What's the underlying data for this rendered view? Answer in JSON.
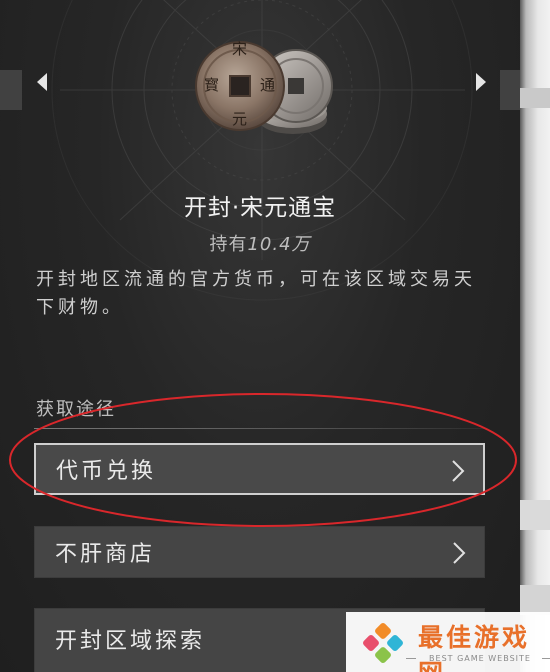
{
  "currency": {
    "name": "开封·宋元通宝",
    "holding_prefix": "持有",
    "holding_amount": "10.4万",
    "description": "开封地区流通的官方货币，可在该区域交易天下财物。",
    "coin_glyphs": [
      "宋",
      "通",
      "元",
      "寳"
    ]
  },
  "acquire": {
    "section_label": "获取途径",
    "items": [
      {
        "label": "代币兑换",
        "icon": "chevron-right-icon"
      },
      {
        "label": "不肝商店",
        "icon": "chevron-right-icon"
      },
      {
        "label": "开封区域探索",
        "icon": "chevron-right-icon"
      }
    ]
  },
  "nav": {
    "prev_icon": "caret-left-icon",
    "next_icon": "caret-right-icon"
  },
  "watermark": {
    "title": "最佳游戏网",
    "subtitle": "BEST GAME WEBSITE"
  },
  "colors": {
    "panel_bg": "#262626",
    "button_bg": "#454545",
    "highlight_ellipse": "#d9272b",
    "watermark_orange": "#e8702a"
  }
}
